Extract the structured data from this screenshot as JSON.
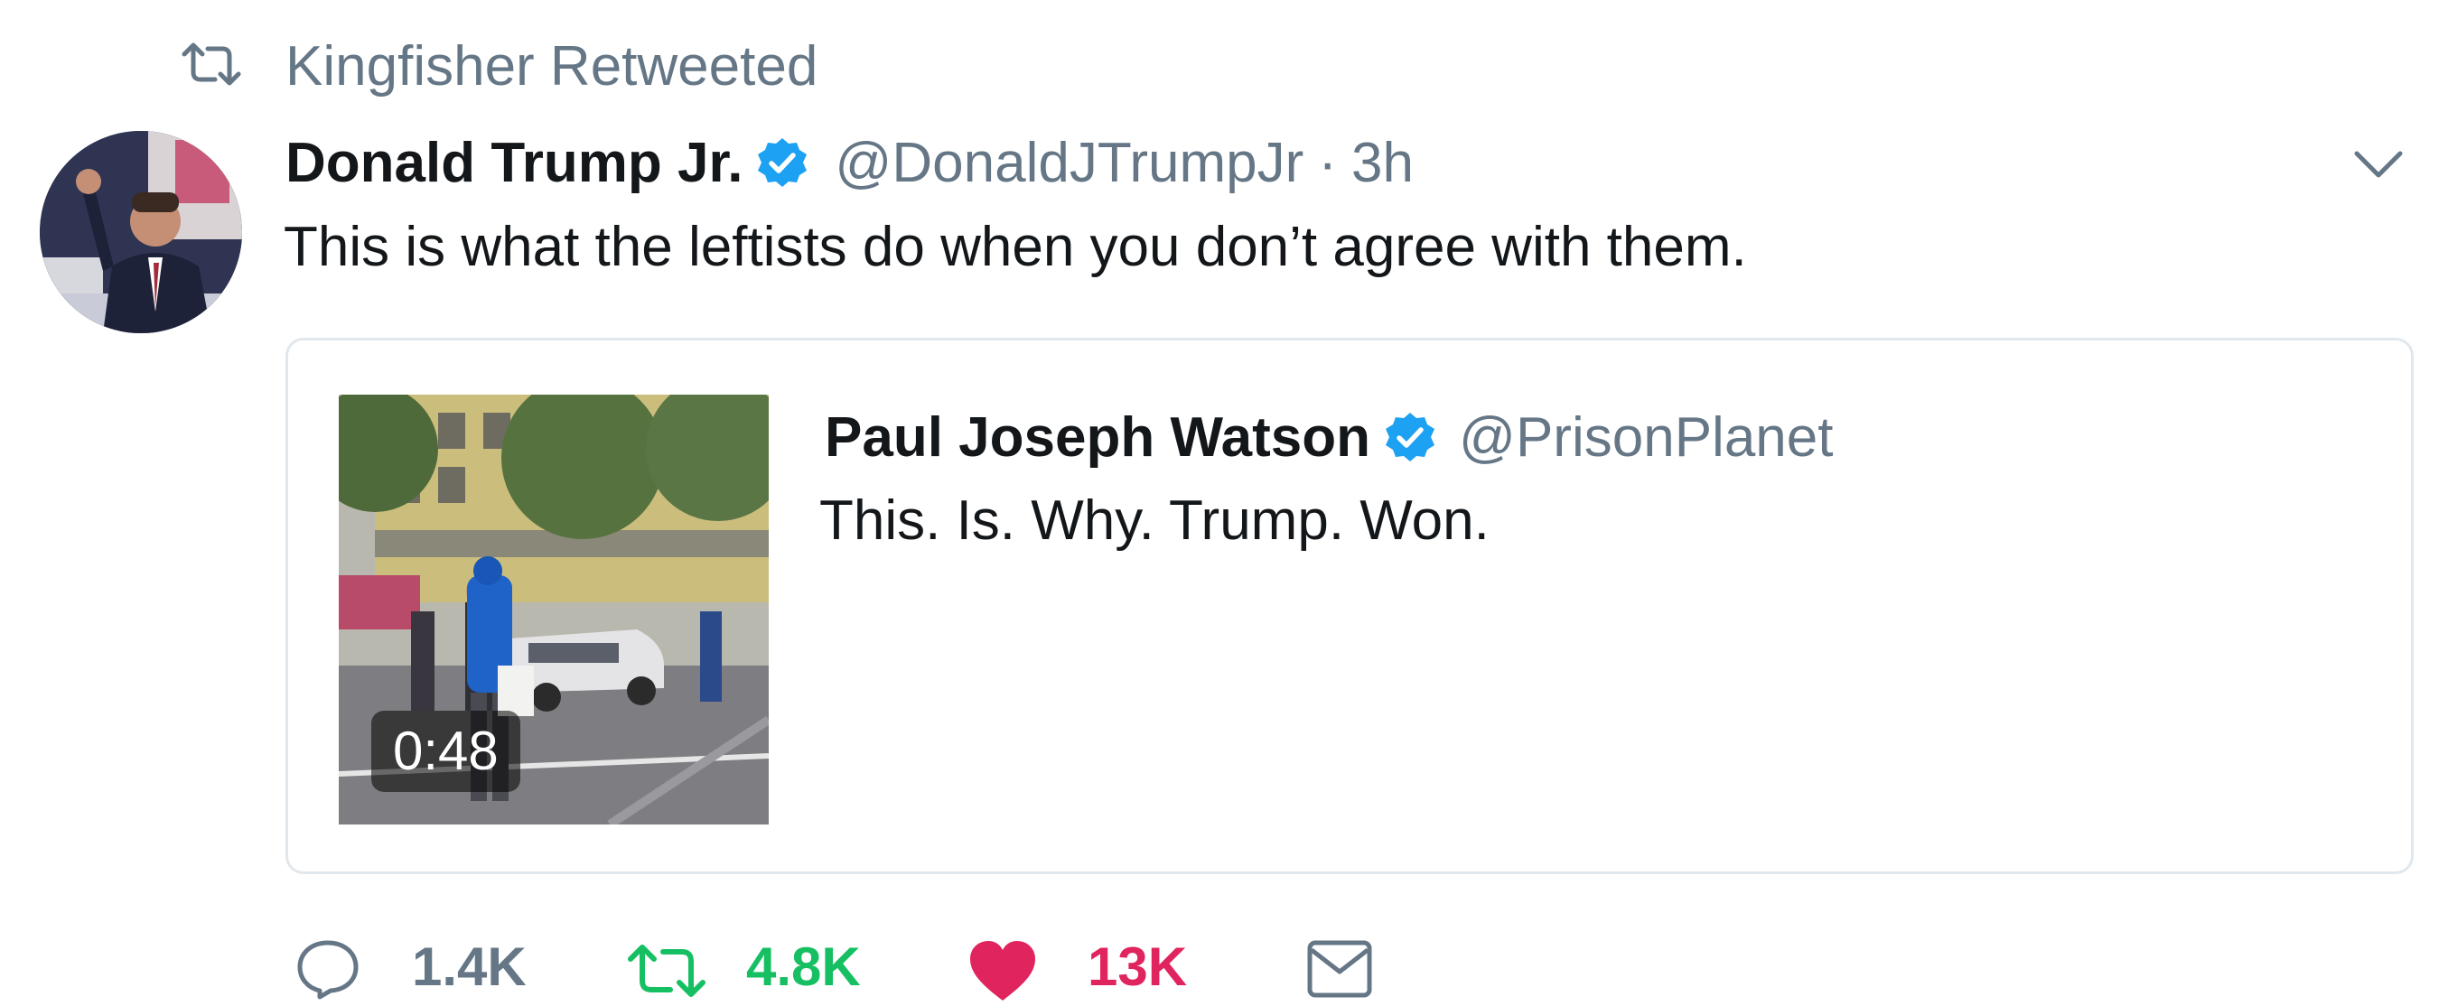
{
  "retweet_context": {
    "text": "Kingfisher Retweeted",
    "icon": "retweet-icon"
  },
  "tweet": {
    "author_name": "Donald Trump Jr.",
    "author_handle": "@DonaldJTrumpJr",
    "separator": "·",
    "time": "3h",
    "text": "This is what the leftists do when you don’t agree with them.",
    "verified": true
  },
  "quote": {
    "author_name": "Paul Joseph Watson",
    "author_handle": "@PrisonPlanet",
    "text": "This. Is. Why. Trump. Won.",
    "video_duration": "0:48",
    "verified": true
  },
  "actions": {
    "reply_count": "1.4K",
    "retweet_count": "4.8K",
    "like_count": "13K",
    "icons": [
      "reply-icon",
      "retweet-icon",
      "heart-icon",
      "envelope-icon"
    ]
  },
  "colors": {
    "text": "#14171a",
    "secondary": "#657786",
    "verified": "#1da1f2",
    "retweet": "#17bf63",
    "like": "#e0245e",
    "border": "#e1e8ed"
  }
}
